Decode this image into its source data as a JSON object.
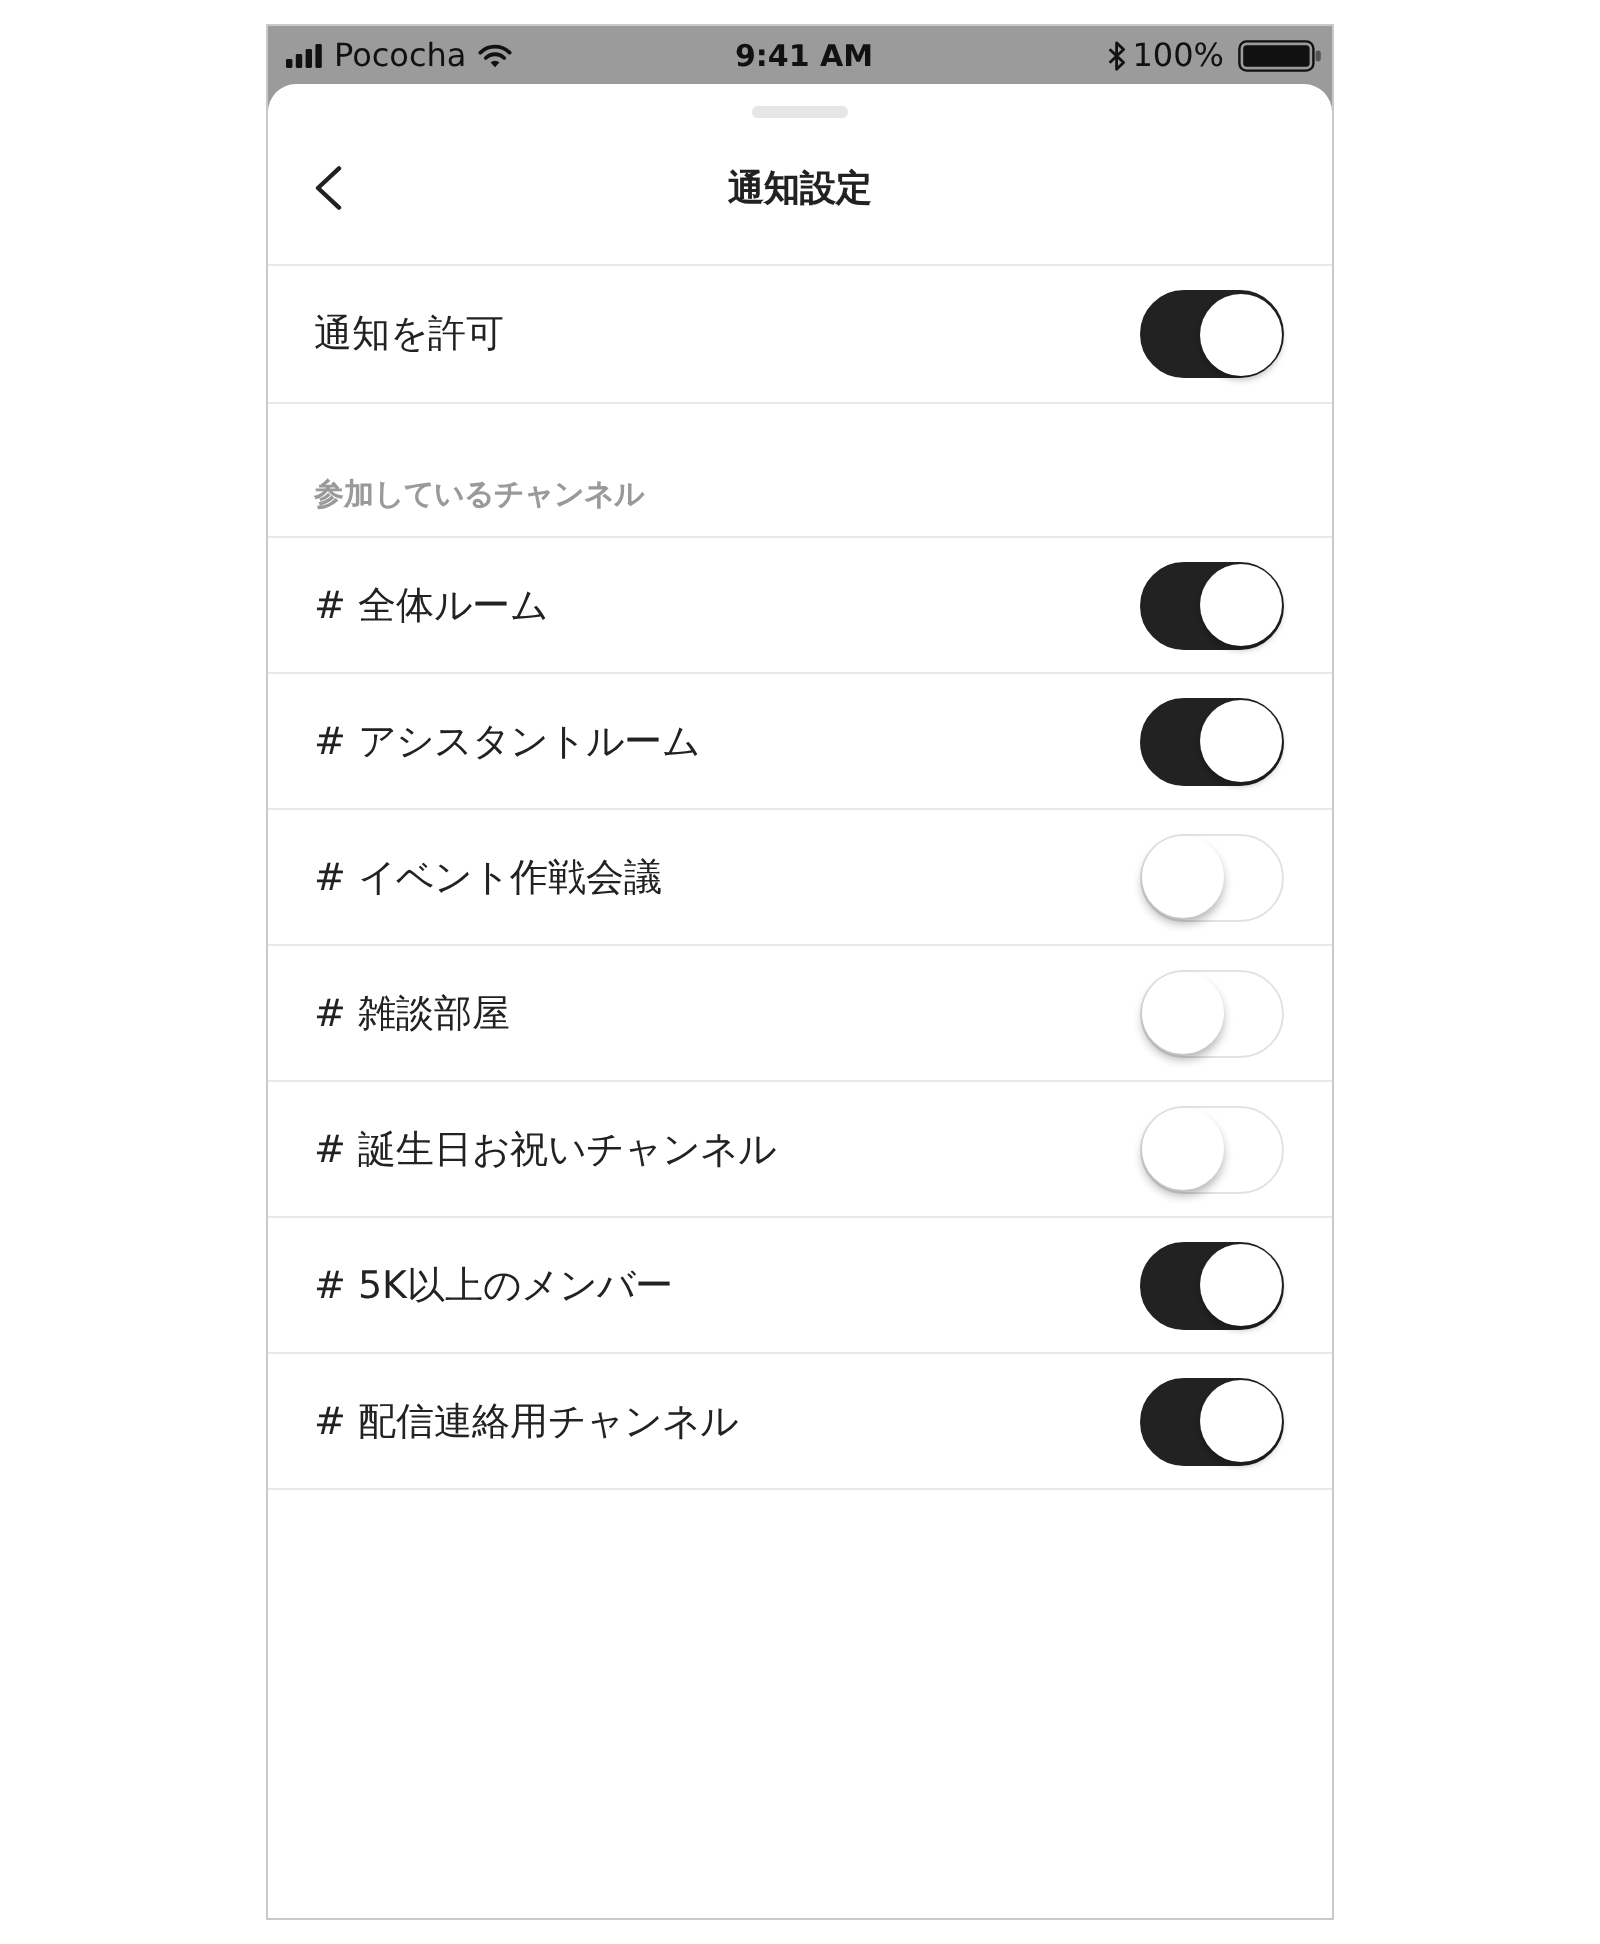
{
  "status_bar": {
    "carrier": "Pococha",
    "time": "9:41 AM",
    "battery": "100%"
  },
  "header": {
    "title": "通知設定"
  },
  "allow_notifications": {
    "label": "通知を許可",
    "on": true
  },
  "channels_section": {
    "heading": "参加しているチャンネル",
    "channels": [
      {
        "label": "# 全体ルーム",
        "on": true
      },
      {
        "label": "# アシスタントルーム",
        "on": true
      },
      {
        "label": "# イベント作戦会議",
        "on": false
      },
      {
        "label": "# 雑談部屋",
        "on": false
      },
      {
        "label": "# 誕生日お祝いチャンネル",
        "on": false
      },
      {
        "label": "# 5K以上のメンバー",
        "on": true
      },
      {
        "label": "# 配信連絡用チャンネル",
        "on": true
      }
    ]
  }
}
